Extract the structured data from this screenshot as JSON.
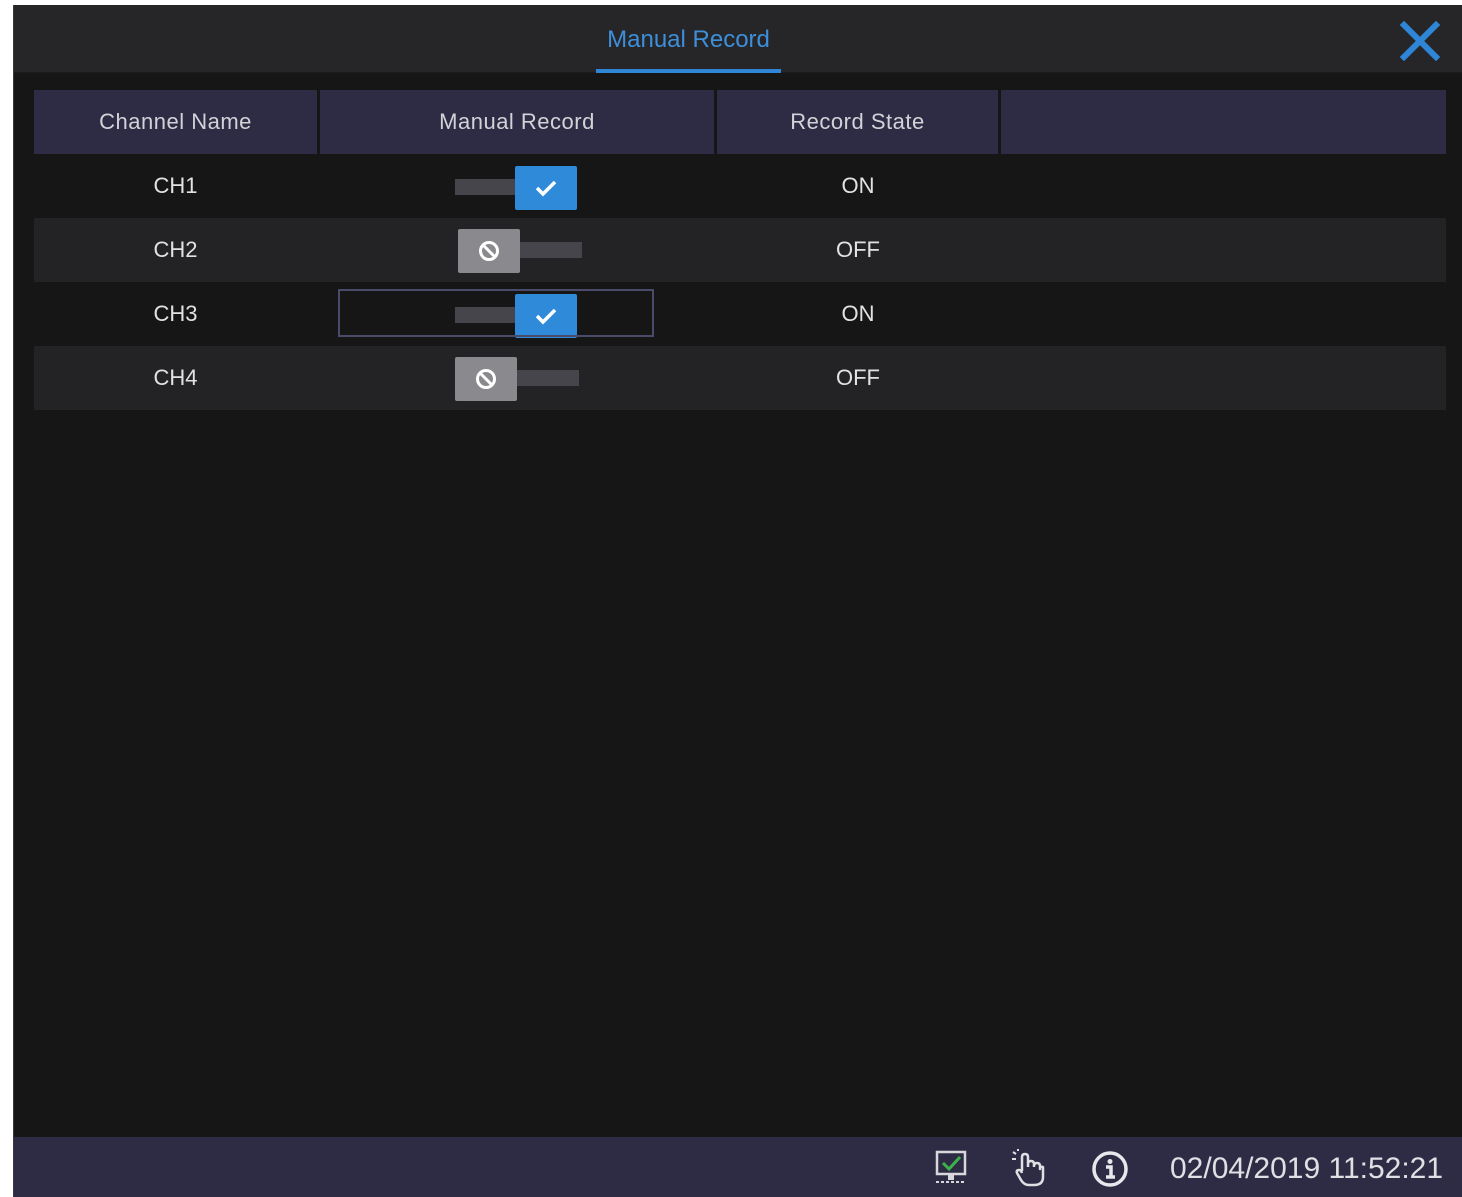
{
  "window": {
    "title": "Manual Record"
  },
  "table": {
    "headers": [
      "Channel Name",
      "Manual Record",
      "Record State",
      ""
    ],
    "rows": [
      {
        "channel": "CH1",
        "manual_record": true,
        "state": "ON"
      },
      {
        "channel": "CH2",
        "manual_record": false,
        "state": "OFF"
      },
      {
        "channel": "CH3",
        "manual_record": true,
        "state": "ON"
      },
      {
        "channel": "CH4",
        "manual_record": false,
        "state": "OFF"
      }
    ]
  },
  "icons": {
    "close": "close-icon",
    "toggle_on": "check-icon",
    "toggle_off": "prohibited-icon",
    "network": "network-status-icon",
    "touch": "touch-hand-icon",
    "info": "info-icon"
  },
  "statusbar": {
    "datetime": "02/04/2019 11:52:21"
  },
  "colors": {
    "accent": "#2f86d6",
    "header_bg": "#2e2c44",
    "toggle_on": "#2f8ad9",
    "toggle_off": "#8a8a8e",
    "network_ok": "#3cb24a"
  }
}
